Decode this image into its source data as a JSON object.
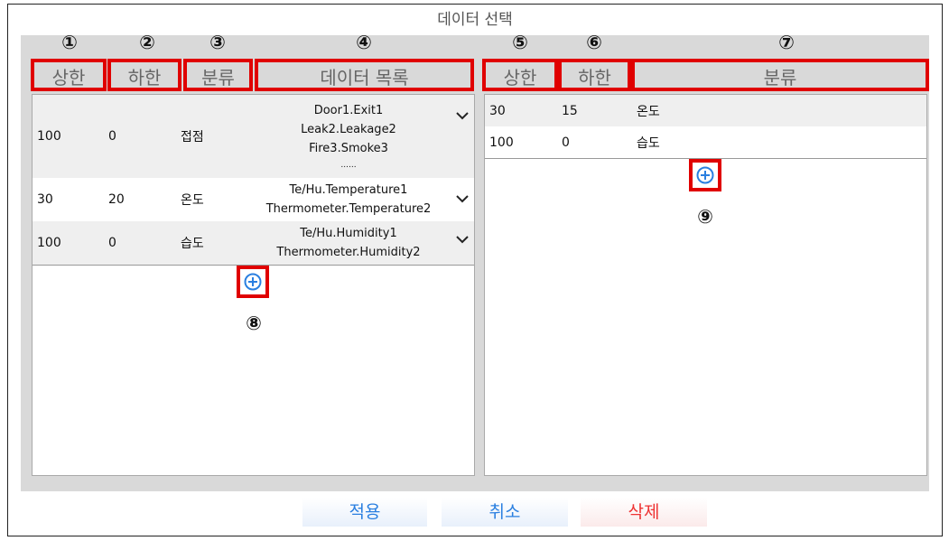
{
  "dialog": {
    "title": "데이터 선택"
  },
  "markers": [
    "①",
    "②",
    "③",
    "④",
    "⑤",
    "⑥",
    "⑦",
    "⑧",
    "⑨"
  ],
  "left_table": {
    "headers": [
      "상한",
      "하한",
      "분류",
      "데이터 목록"
    ],
    "rows": [
      {
        "upper": "100",
        "lower": "0",
        "category": "접점",
        "items": [
          "Door1.Exit1",
          "Leak2.Leakage2",
          "Fire3.Smoke3",
          "......"
        ]
      },
      {
        "upper": "30",
        "lower": "20",
        "category": "온도",
        "items": [
          "Te/Hu.Temperature1",
          "Thermometer.Temperature2"
        ]
      },
      {
        "upper": "100",
        "lower": "0",
        "category": "습도",
        "items": [
          "Te/Hu.Humidity1",
          "Thermometer.Humidity2"
        ]
      }
    ]
  },
  "right_table": {
    "headers": [
      "상한",
      "하한",
      "분류"
    ],
    "rows": [
      {
        "upper": "30",
        "lower": "15",
        "category": "온도"
      },
      {
        "upper": "100",
        "lower": "0",
        "category": "습도"
      }
    ]
  },
  "buttons": {
    "apply": "적용",
    "cancel": "취소",
    "delete": "삭제"
  },
  "colors": {
    "annotation_red": "#e00000",
    "accent_blue": "#2a7fe0",
    "delete_red": "#ee3333"
  },
  "icons": {
    "expand": "chevron-down-icon",
    "add": "plus-circle-icon"
  }
}
